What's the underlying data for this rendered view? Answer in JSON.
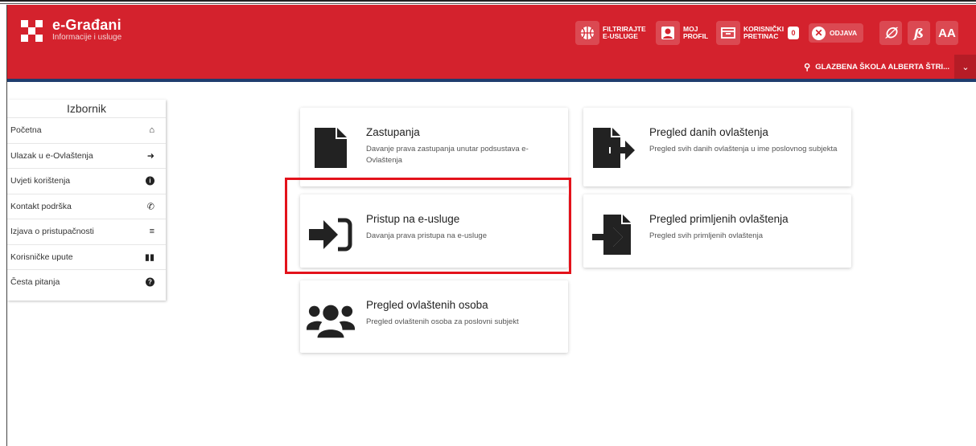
{
  "brand": {
    "title": "e-Građani",
    "subtitle": "Informacije i usluge"
  },
  "header": {
    "filter_line1": "FILTRIRAJTE",
    "filter_line2": "E-USLUGE",
    "profile_line1": "MOJ",
    "profile_line2": "PROFIL",
    "inbox_line1": "KORISNIČKI",
    "inbox_line2": "PRETINAC",
    "inbox_count": "0",
    "logout": "ODJAVA",
    "font_btn": "AA"
  },
  "org": {
    "name": "GLAZBENA ŠKOLA ALBERTA ŠTRI..."
  },
  "sidebar": {
    "title": "Izbornik",
    "items": [
      {
        "label": "Početna",
        "icon": "home-icon"
      },
      {
        "label": "Ulazak u e-Ovlaštenja",
        "icon": "sign-in-icon"
      },
      {
        "label": "Uvjeti korištenja",
        "icon": "info-icon"
      },
      {
        "label": "Kontakt podrška",
        "icon": "phone-icon"
      },
      {
        "label": "Izjava o pristupačnosti",
        "icon": "align-center-icon"
      },
      {
        "label": "Korisničke upute",
        "icon": "book-icon"
      },
      {
        "label": "Česta pitanja",
        "icon": "question-icon"
      }
    ]
  },
  "cards": [
    {
      "title": "Zastupanja",
      "desc": "Davanje prava zastupanja unutar podsustava e-Ovlaštenja",
      "icon": "file-icon"
    },
    {
      "title": "Pregled danih ovlaštenja",
      "desc": "Pregled svih danih ovlaštenja u ime poslovnog subjekta",
      "icon": "file-export-icon"
    },
    {
      "title": "Pristup na e-usluge",
      "desc": "Davanja prava pristupa na e-usluge",
      "icon": "sign-in-alt-icon"
    },
    {
      "title": "Pregled primljenih ovlaštenja",
      "desc": "Pregled svih primljenih ovlaštenja",
      "icon": "file-import-icon"
    },
    {
      "title": "Pregled ovlaštenih osoba",
      "desc": "Pregled ovlaštenih osoba za poslovni subjekt",
      "icon": "users-icon"
    }
  ],
  "colors": {
    "brand_red": "#d4222d",
    "navy_accent": "#1f3d6e",
    "highlight": "#e3121b"
  }
}
